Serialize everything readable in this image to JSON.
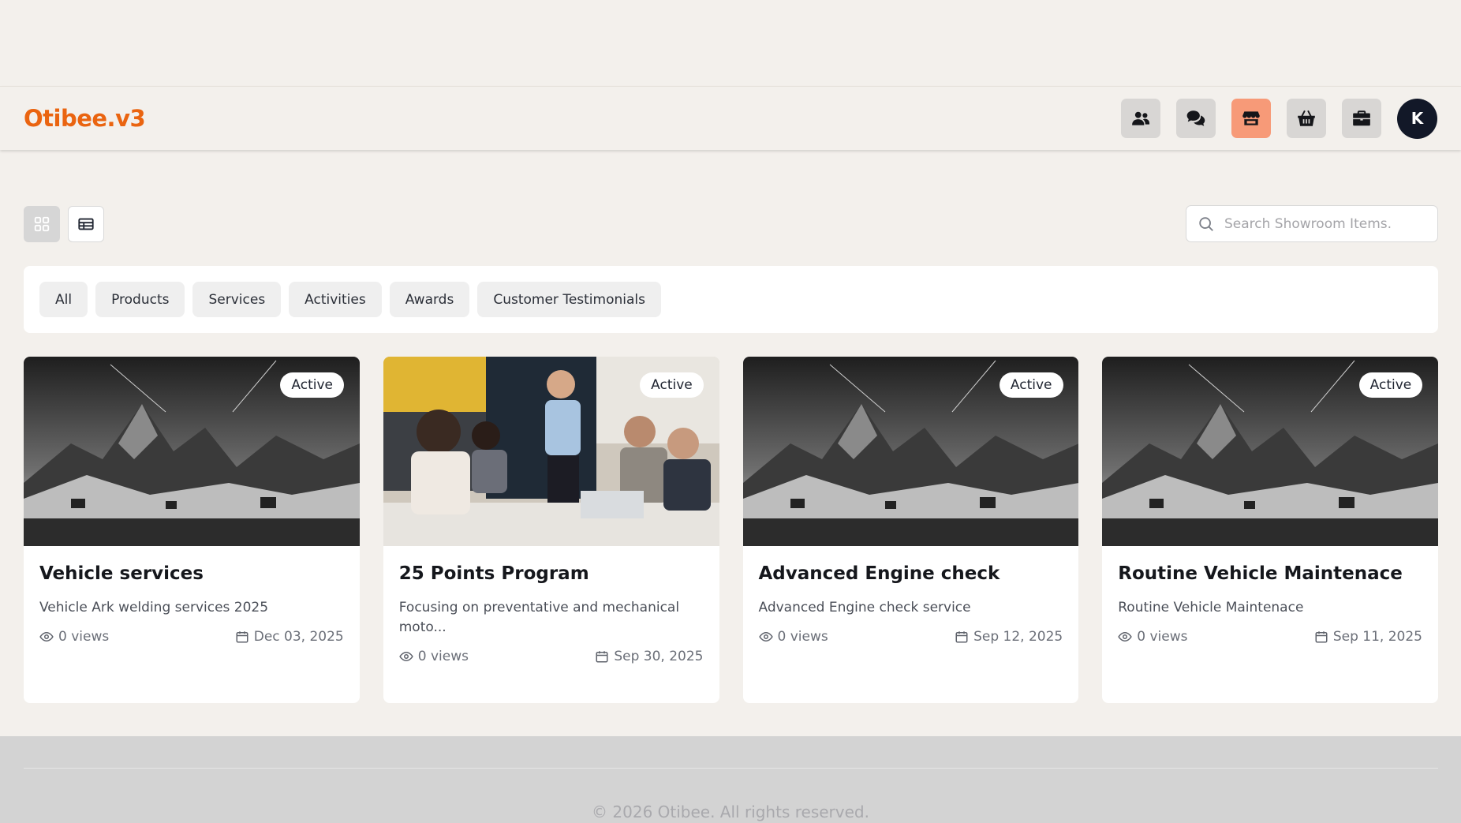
{
  "app": {
    "logo": "Otibee.v3"
  },
  "nav": {
    "icons": [
      "users-icon",
      "chat-icon",
      "store-icon",
      "basket-icon",
      "briefcase-icon"
    ],
    "active": "store-icon",
    "avatar_initial": "K"
  },
  "colors": {
    "brand": "#ea6410",
    "active_nav": "#f79a78",
    "avatar_bg": "#121828"
  },
  "search": {
    "placeholder": "Search Showroom Items."
  },
  "filters": [
    "All",
    "Products",
    "Services",
    "Activities",
    "Awards",
    "Customer Testimonials"
  ],
  "cards": [
    {
      "title": "Vehicle services",
      "desc": "Vehicle Ark welding services 2025",
      "status": "Active",
      "views": "0 views",
      "date": "Dec 03, 2025",
      "image": "mountain-landscape"
    },
    {
      "title": "25 Points Program",
      "desc": "Focusing on preventative and mechanical moto...",
      "status": "Active",
      "views": "0 views",
      "date": "Sep 30, 2025",
      "image": "business-meeting"
    },
    {
      "title": "Advanced Engine check",
      "desc": "Advanced Engine check service",
      "status": "Active",
      "views": "0 views",
      "date": "Sep 12, 2025",
      "image": "mountain-landscape"
    },
    {
      "title": "Routine Vehicle Maintenace",
      "desc": "Routine Vehicle Maintenace",
      "status": "Active",
      "views": "0 views",
      "date": "Sep 11, 2025",
      "image": "mountain-landscape"
    }
  ],
  "footer": {
    "copyright": "© 2026 Otibee. All rights reserved."
  }
}
